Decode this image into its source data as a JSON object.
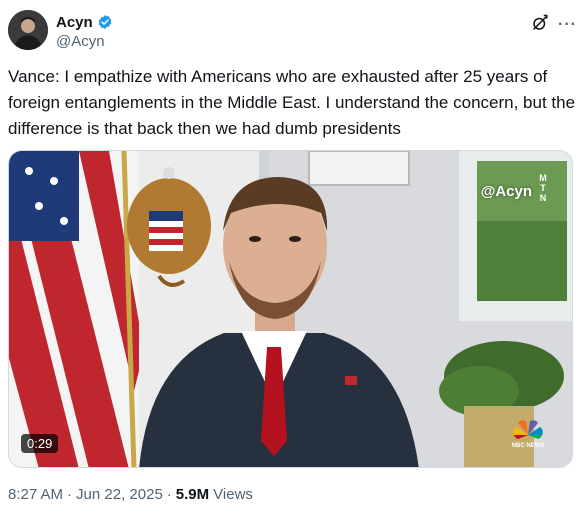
{
  "author": {
    "display_name": "Acyn",
    "handle": "@Acyn",
    "verified": true,
    "avatar_icon": "avatar-image"
  },
  "header_actions": {
    "grok_icon": "grok-icon",
    "more_icon": "more-options-icon"
  },
  "tweet": {
    "text": "Vance: I empathize with Americans who are exhausted after 25 years of foreign entanglements in the Middle East. I understand the concern, but the difference is that back then we had dumb presidents"
  },
  "video": {
    "duration": "0:29",
    "watermark": "@Acyn",
    "watermark_logo": "M T N",
    "network_logo_text": "NBC NEWS"
  },
  "meta": {
    "time": "8:27 AM",
    "separator": "·",
    "date": "Jun 22, 2025",
    "views_count": "5.9M",
    "views_label": "Views"
  },
  "colors": {
    "verified_blue": "#1d9bf0",
    "text_primary": "#0f1419",
    "text_secondary": "#536471",
    "tie_red": "#b3121e",
    "suit_navy": "#27303f"
  }
}
